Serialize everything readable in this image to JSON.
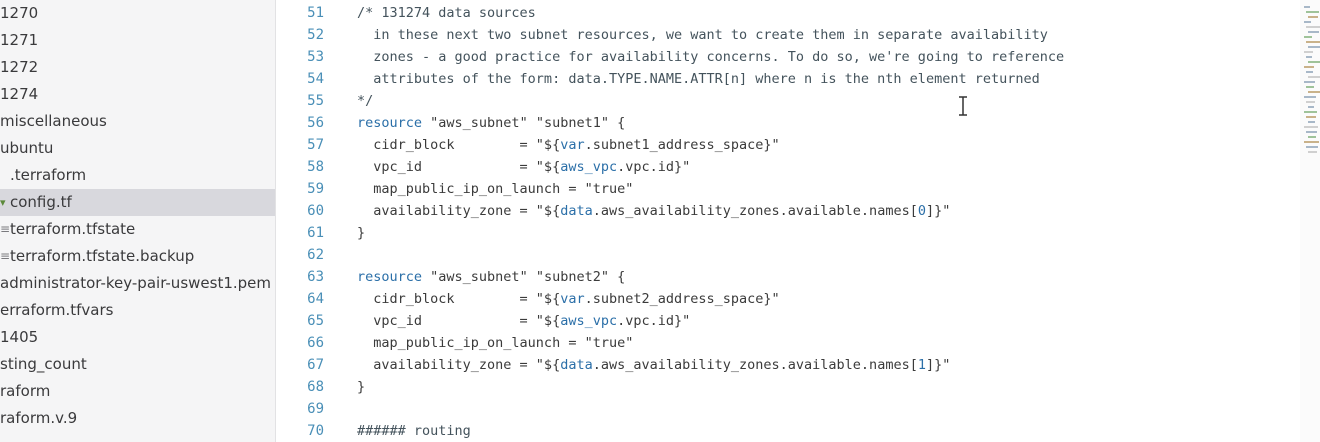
{
  "sidebar": {
    "items": [
      {
        "label": "1270",
        "icon": "none",
        "indent": 0,
        "selected": false
      },
      {
        "label": "1271",
        "icon": "none",
        "indent": 0,
        "selected": false
      },
      {
        "label": "1272",
        "icon": "none",
        "indent": 0,
        "selected": false
      },
      {
        "label": "1274",
        "icon": "none",
        "indent": 0,
        "selected": false
      },
      {
        "label": "miscellaneous",
        "icon": "none",
        "indent": 0,
        "selected": false
      },
      {
        "label": "ubuntu",
        "icon": "none",
        "indent": 0,
        "selected": false
      },
      {
        "label": ".terraform",
        "icon": "none",
        "indent": 1,
        "selected": false
      },
      {
        "label": "config.tf",
        "icon": "terraform-file-icon",
        "indent": 1,
        "selected": true
      },
      {
        "label": "terraform.tfstate",
        "icon": "text-file-icon",
        "indent": 1,
        "selected": false
      },
      {
        "label": "terraform.tfstate.backup",
        "icon": "text-file-icon",
        "indent": 1,
        "selected": false
      },
      {
        "label": "administrator-key-pair-uswest1.pem",
        "icon": "none",
        "indent": 0,
        "selected": false
      },
      {
        "label": "erraform.tfvars",
        "icon": "none",
        "indent": 0,
        "selected": false
      },
      {
        "label": "1405",
        "icon": "none",
        "indent": 0,
        "selected": false
      },
      {
        "label": "sting_count",
        "icon": "none",
        "indent": 0,
        "selected": false
      },
      {
        "label": "raform",
        "icon": "none",
        "indent": 0,
        "selected": false
      },
      {
        "label": "raform.v.9",
        "icon": "none",
        "indent": 0,
        "selected": false
      }
    ]
  },
  "editor": {
    "lines": [
      {
        "no": "51",
        "tokens": [
          {
            "t": "/* 131274 data sources",
            "c": "comment"
          }
        ]
      },
      {
        "no": "52",
        "tokens": [
          {
            "t": "  in these next two subnet resources, we want to create them in separate availability",
            "c": "comment"
          }
        ]
      },
      {
        "no": "53",
        "tokens": [
          {
            "t": "  zones - a good practice for availability concerns. To do so, we're going to reference",
            "c": "comment"
          }
        ]
      },
      {
        "no": "54",
        "tokens": [
          {
            "t": "  attributes of the form: data.TYPE.NAME.ATTR[n] where n is the nth element returned",
            "c": "comment"
          }
        ]
      },
      {
        "no": "55",
        "tokens": [
          {
            "t": "*/",
            "c": "comment"
          }
        ]
      },
      {
        "no": "56",
        "tokens": [
          {
            "t": "resource",
            "c": "keyword"
          },
          {
            "t": " \"aws_subnet\" \"subnet1\" {",
            "c": "plain"
          }
        ]
      },
      {
        "no": "57",
        "tokens": [
          {
            "t": "  cidr_block        = \"${",
            "c": "plain"
          },
          {
            "t": "var",
            "c": "var"
          },
          {
            "t": ".subnet1_address_space}\"",
            "c": "plain"
          }
        ]
      },
      {
        "no": "58",
        "tokens": [
          {
            "t": "  vpc_id            = \"${",
            "c": "plain"
          },
          {
            "t": "aws_vpc",
            "c": "var"
          },
          {
            "t": ".vpc.id}\"",
            "c": "plain"
          }
        ]
      },
      {
        "no": "59",
        "tokens": [
          {
            "t": "  map_public_ip_on_launch = \"true\"",
            "c": "plain"
          }
        ]
      },
      {
        "no": "60",
        "tokens": [
          {
            "t": "  availability_zone = \"${",
            "c": "plain"
          },
          {
            "t": "data",
            "c": "var"
          },
          {
            "t": ".aws_availability_zones.available.names[",
            "c": "plain"
          },
          {
            "t": "0",
            "c": "var"
          },
          {
            "t": "]}\"",
            "c": "plain"
          }
        ]
      },
      {
        "no": "61",
        "tokens": [
          {
            "t": "}",
            "c": "plain"
          }
        ]
      },
      {
        "no": "62",
        "tokens": []
      },
      {
        "no": "63",
        "tokens": [
          {
            "t": "resource",
            "c": "keyword"
          },
          {
            "t": " \"aws_subnet\" \"subnet2\" {",
            "c": "plain"
          }
        ]
      },
      {
        "no": "64",
        "tokens": [
          {
            "t": "  cidr_block        = \"${",
            "c": "plain"
          },
          {
            "t": "var",
            "c": "var"
          },
          {
            "t": ".subnet2_address_space}\"",
            "c": "plain"
          }
        ]
      },
      {
        "no": "65",
        "tokens": [
          {
            "t": "  vpc_id            = \"${",
            "c": "plain"
          },
          {
            "t": "aws_vpc",
            "c": "var"
          },
          {
            "t": ".vpc.id}\"",
            "c": "plain"
          }
        ]
      },
      {
        "no": "66",
        "tokens": [
          {
            "t": "  map_public_ip_on_launch = \"true\"",
            "c": "plain"
          }
        ]
      },
      {
        "no": "67",
        "tokens": [
          {
            "t": "  availability_zone = \"${",
            "c": "plain"
          },
          {
            "t": "data",
            "c": "var"
          },
          {
            "t": ".aws_availability_zones.available.names[",
            "c": "plain"
          },
          {
            "t": "1",
            "c": "var"
          },
          {
            "t": "]}\"",
            "c": "plain"
          }
        ]
      },
      {
        "no": "68",
        "tokens": [
          {
            "t": "}",
            "c": "plain"
          }
        ]
      },
      {
        "no": "69",
        "tokens": []
      },
      {
        "no": "70",
        "tokens": [
          {
            "t": "###### routing",
            "c": "comment"
          }
        ]
      }
    ]
  },
  "colors": {
    "line_number": "#4a8fb7",
    "keyword": "#2b6fa8",
    "selection": "#d8d8dd"
  }
}
